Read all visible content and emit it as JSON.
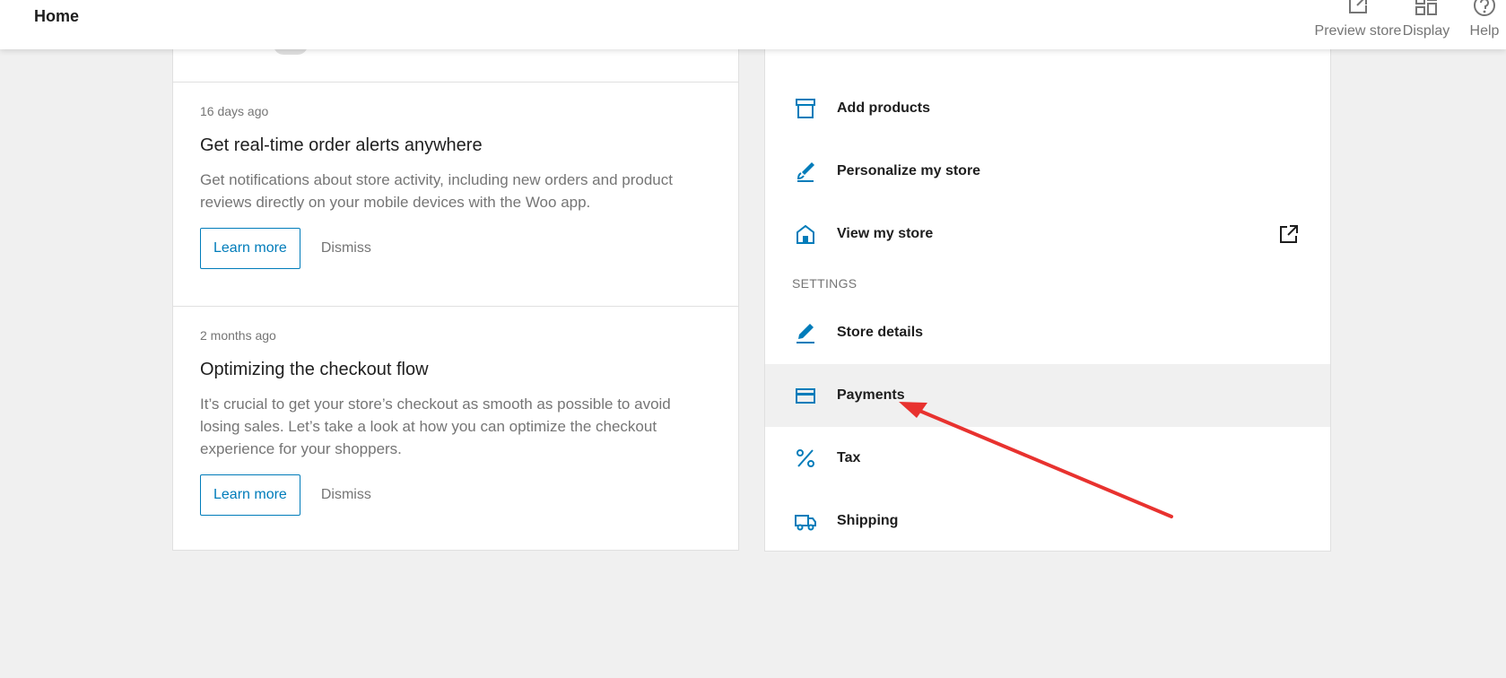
{
  "header": {
    "title": "Home",
    "preview_label": "Preview store",
    "display_label": "Display",
    "help_label": "Help"
  },
  "inbox": {
    "notes": [
      {
        "when": "16 days ago",
        "title": "Get real-time order alerts anywhere",
        "body": "Get notifications about store activity, including new orders and product reviews directly on your mobile devices with the Woo app.",
        "learn_more": "Learn more",
        "dismiss": "Dismiss"
      },
      {
        "when": "2 months ago",
        "title": "Optimizing the checkout flow",
        "body": "It’s crucial to get your store’s checkout as smooth as possible to avoid losing sales. Let’s take a look at how you can optimize the checkout experience for your shoppers.",
        "learn_more": "Learn more",
        "dismiss": "Dismiss"
      }
    ]
  },
  "store": {
    "items": [
      {
        "label": "Add products",
        "icon": "archive-icon"
      },
      {
        "label": "Personalize my store",
        "icon": "brush-icon"
      },
      {
        "label": "View my store",
        "icon": "home-icon"
      }
    ],
    "settings_heading": "SETTINGS",
    "settings": [
      {
        "label": "Store details",
        "icon": "pencil-icon"
      },
      {
        "label": "Payments",
        "icon": "credit-card-icon"
      },
      {
        "label": "Tax",
        "icon": "percent-icon"
      },
      {
        "label": "Shipping",
        "icon": "truck-icon"
      }
    ]
  },
  "colors": {
    "accent": "#007cba",
    "annotation_arrow": "#e8322f",
    "background": "#f0f0f0"
  }
}
